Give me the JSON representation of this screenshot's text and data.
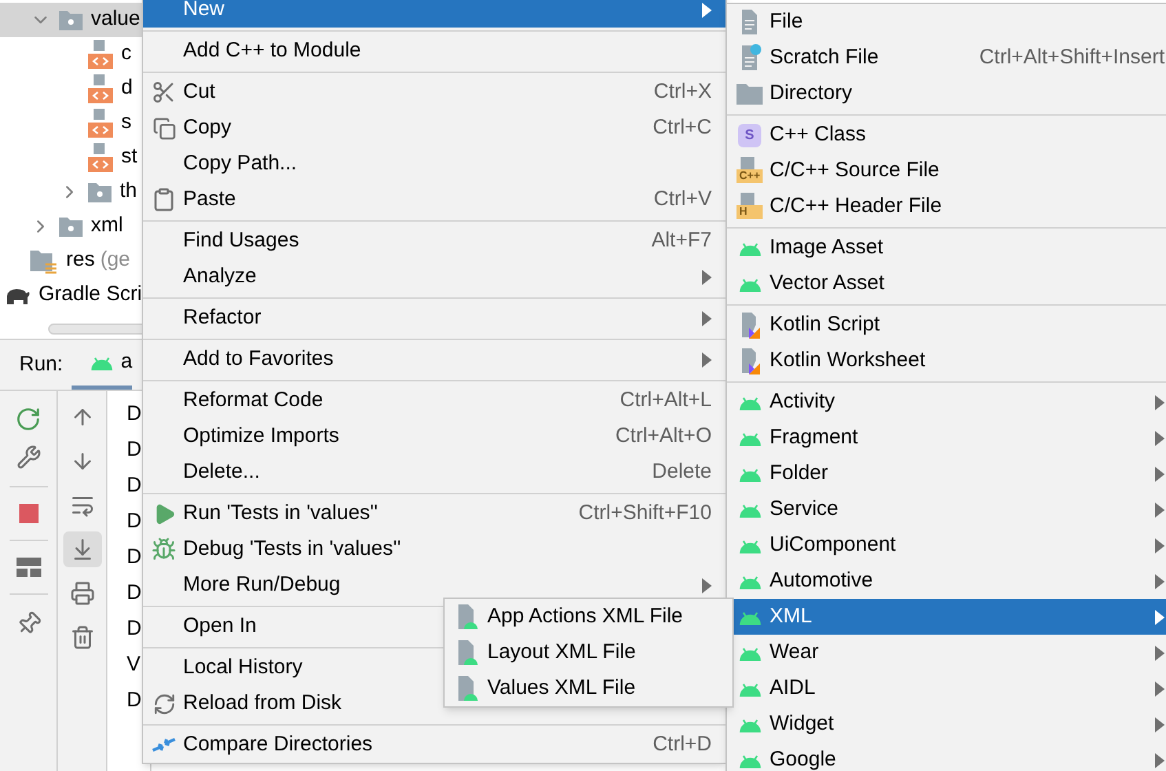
{
  "project_tree": [
    {
      "label": "value",
      "kind": "folder",
      "expanded": true,
      "selected": true,
      "children": [
        {
          "label": "c",
          "kind": "xml_file",
          "selected": false
        },
        {
          "label": "d",
          "kind": "xml_file",
          "selected": false
        },
        {
          "label": "s",
          "kind": "xml_file",
          "selected": false
        },
        {
          "label": "st",
          "kind": "xml_file",
          "selected": false
        },
        {
          "label": "th",
          "kind": "folder",
          "expanded": false,
          "selected": false
        }
      ]
    },
    {
      "label": "xml",
      "kind": "folder",
      "expanded": false,
      "selected": false
    },
    {
      "label": "res",
      "note": "(ge",
      "kind": "res_folder",
      "selected": false
    },
    {
      "label": "Gradle Scri",
      "kind": "gradle",
      "selected": false
    }
  ],
  "run_panel": {
    "label": "Run:",
    "tabs": [
      {
        "label": "a",
        "selected": true
      }
    ],
    "secondary_toolbar": [
      {
        "on": false
      },
      {
        "on": false
      },
      {
        "on": false
      },
      {
        "on": true
      },
      {
        "on": false
      },
      {
        "on": false
      }
    ],
    "console_lines": [
      "D",
      "D",
      "D",
      "D",
      "D",
      "D",
      "D",
      "V",
      "D"
    ]
  },
  "context_menu": {
    "groups": [
      [
        {
          "label": "New",
          "kind": "plain",
          "has_submenu": true,
          "selected": true
        }
      ],
      [
        {
          "label": "Add C++ to Module",
          "kind": "plain",
          "has_submenu": false,
          "selected": false
        }
      ],
      [
        {
          "label": "Cut",
          "shortcut": "Ctrl+X",
          "kind": "scissors",
          "has_submenu": false,
          "selected": false
        },
        {
          "label": "Copy",
          "shortcut": "Ctrl+C",
          "kind": "copy",
          "has_submenu": false,
          "selected": false
        },
        {
          "label": "Copy Path...",
          "kind": "plain",
          "has_submenu": false,
          "selected": false
        },
        {
          "label": "Paste",
          "shortcut": "Ctrl+V",
          "kind": "clipboard",
          "has_submenu": false,
          "selected": false
        }
      ],
      [
        {
          "label": "Find Usages",
          "shortcut": "Alt+F7",
          "kind": "plain",
          "has_submenu": false,
          "selected": false
        },
        {
          "label": "Analyze",
          "kind": "plain",
          "has_submenu": true,
          "selected": false
        }
      ],
      [
        {
          "label": "Refactor",
          "kind": "plain",
          "has_submenu": true,
          "selected": false
        }
      ],
      [
        {
          "label": "Add to Favorites",
          "kind": "plain",
          "has_submenu": true,
          "selected": false
        }
      ],
      [
        {
          "label": "Reformat Code",
          "shortcut": "Ctrl+Alt+L",
          "kind": "plain",
          "has_submenu": false,
          "selected": false
        },
        {
          "label": "Optimize Imports",
          "shortcut": "Ctrl+Alt+O",
          "kind": "plain",
          "has_submenu": false,
          "selected": false
        },
        {
          "label": "Delete...",
          "shortcut": "Delete",
          "kind": "plain",
          "has_submenu": false,
          "selected": false
        }
      ],
      [
        {
          "label": "Run 'Tests in 'values''",
          "shortcut": "Ctrl+Shift+F10",
          "kind": "play",
          "has_submenu": false,
          "selected": false
        },
        {
          "label": "Debug 'Tests in 'values''",
          "kind": "bug",
          "has_submenu": false,
          "selected": false
        },
        {
          "label": "More Run/Debug",
          "kind": "plain",
          "has_submenu": true,
          "selected": false
        }
      ],
      [
        {
          "label": "Open In",
          "kind": "plain",
          "selected": false
        }
      ],
      [
        {
          "label": "Local History",
          "kind": "plain",
          "selected": false
        },
        {
          "label": "Reload from Disk",
          "kind": "reload",
          "has_submenu": false,
          "selected": false
        }
      ],
      [
        {
          "label": "Compare Directories",
          "shortcut": "Ctrl+D",
          "kind": "compare",
          "has_submenu": false,
          "selected": false
        }
      ]
    ]
  },
  "new_submenu": {
    "groups": [
      [
        {
          "label": "File",
          "kind": "file",
          "has_submenu": false,
          "selected": false
        },
        {
          "label": "Scratch File",
          "shortcut": "Ctrl+Alt+Shift+Insert",
          "kind": "scratch",
          "has_submenu": false,
          "selected": false
        },
        {
          "label": "Directory",
          "kind": "folder",
          "has_submenu": false,
          "selected": false
        }
      ],
      [
        {
          "label": "C++ Class",
          "kind": "cpp_class",
          "badge": "S",
          "has_submenu": false,
          "selected": false
        },
        {
          "label": "C/C++ Source File",
          "kind": "cpp_source",
          "badge": "C++",
          "has_submenu": false,
          "selected": false
        },
        {
          "label": "C/C++ Header File",
          "kind": "cpp_header",
          "badge": "H",
          "has_submenu": false,
          "selected": false
        }
      ],
      [
        {
          "label": "Image Asset",
          "kind": "android",
          "has_submenu": false,
          "selected": false
        },
        {
          "label": "Vector Asset",
          "kind": "android",
          "has_submenu": false,
          "selected": false
        }
      ],
      [
        {
          "label": "Kotlin Script",
          "kind": "kotlin",
          "has_submenu": false,
          "selected": false
        },
        {
          "label": "Kotlin Worksheet",
          "kind": "kotlin",
          "has_submenu": false,
          "selected": false
        }
      ],
      [
        {
          "label": "Activity",
          "kind": "android",
          "has_submenu": true,
          "selected": false
        },
        {
          "label": "Fragment",
          "kind": "android",
          "has_submenu": true,
          "selected": false
        },
        {
          "label": "Folder",
          "kind": "android",
          "has_submenu": true,
          "selected": false
        },
        {
          "label": "Service",
          "kind": "android",
          "has_submenu": true,
          "selected": false
        },
        {
          "label": "UiComponent",
          "kind": "android",
          "has_submenu": true,
          "selected": false
        },
        {
          "label": "Automotive",
          "kind": "android",
          "has_submenu": true,
          "selected": false
        },
        {
          "label": "XML",
          "kind": "android",
          "has_submenu": true,
          "selected": true
        },
        {
          "label": "Wear",
          "kind": "android",
          "has_submenu": true,
          "selected": false
        },
        {
          "label": "AIDL",
          "kind": "android",
          "has_submenu": true,
          "selected": false
        },
        {
          "label": "Widget",
          "kind": "android",
          "has_submenu": true,
          "selected": false
        },
        {
          "label": "Google",
          "kind": "android",
          "has_submenu": true,
          "selected": false
        }
      ]
    ]
  },
  "xml_submenu": {
    "groups": [
      [
        {
          "label": "App Actions XML File",
          "kind": "android_file",
          "has_submenu": false,
          "selected": false
        },
        {
          "label": "Layout XML File",
          "kind": "android_file",
          "has_submenu": false,
          "selected": false
        },
        {
          "label": "Values XML File",
          "kind": "android_file",
          "has_submenu": false,
          "selected": false
        }
      ]
    ]
  }
}
